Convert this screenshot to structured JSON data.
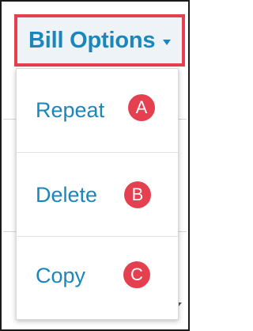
{
  "header": {
    "button_label": "Bill Options",
    "icon": "chevron-down-icon"
  },
  "menu": {
    "items": [
      {
        "label": "Repeat",
        "badge": "A"
      },
      {
        "label": "Delete",
        "badge": "B"
      },
      {
        "label": "Copy",
        "badge": "C"
      }
    ]
  },
  "colors": {
    "accent_text": "#1a86bb",
    "highlight_border": "#e5404f",
    "badge_fill": "#e5404f"
  }
}
